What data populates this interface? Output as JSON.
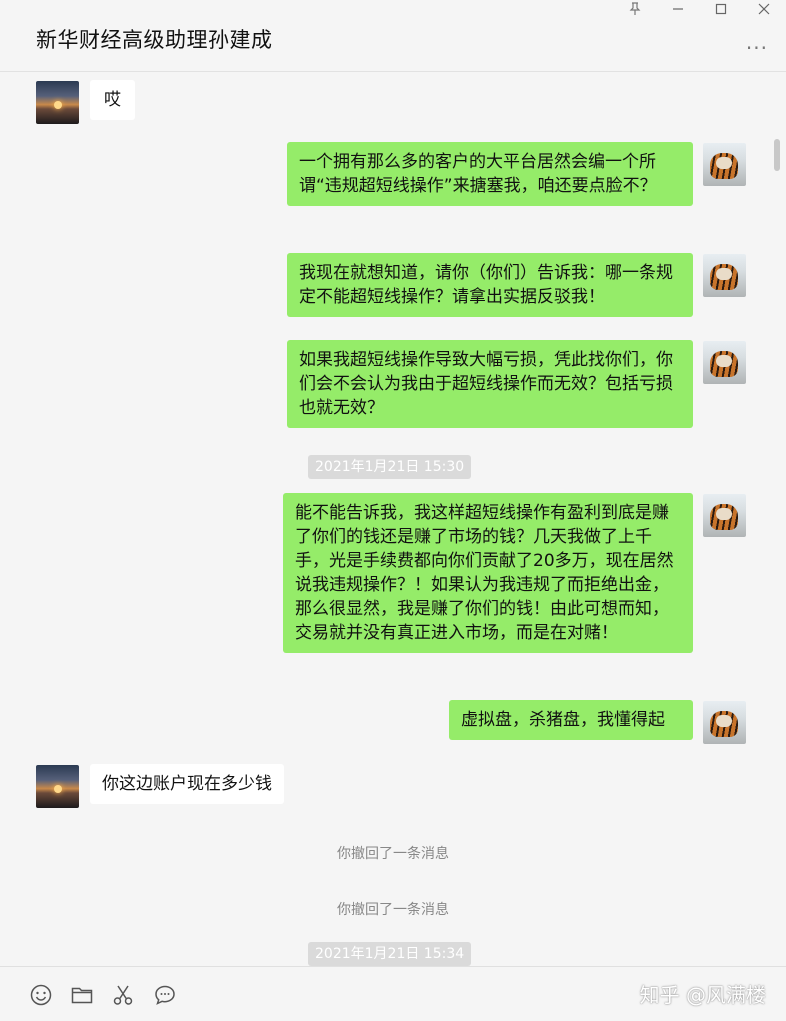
{
  "window": {
    "title": "新华财经高级助理孙建成",
    "more_label": "···"
  },
  "messages": [
    {
      "side": "left",
      "avatar": "sunset-avatar",
      "text": "哎"
    },
    {
      "side": "right",
      "avatar": "tiger-avatar",
      "text": "一个拥有那么多的客户的大平台居然会编一个所谓“违规超短线操作”来搪塞我，咱还要点脸不？"
    },
    {
      "side": "right",
      "avatar": "tiger-avatar",
      "text": "我现在就想知道，请你（你们）告诉我：哪一条规定不能超短线操作？请拿出实据反驳我！"
    },
    {
      "side": "right",
      "avatar": "tiger-avatar",
      "text": "如果我超短线操作导致大幅亏损，凭此找你们，你们会不会认为我由于超短线操作而无效？包括亏损也就无效？"
    },
    {
      "type": "time",
      "text": "2021年1月21日 15:30"
    },
    {
      "side": "right",
      "avatar": "tiger-avatar",
      "text": "能不能告诉我，我这样超短线操作有盈利到底是赚了你们的钱还是赚了市场的钱？几天我做了上千手，光是手续费都向你们贡献了20多万，现在居然说我违规操作？！如果认为我违规了而拒绝出金，那么很显然，我是赚了你们的钱！由此可想而知，交易就并没有真正进入市场，而是在对赌！"
    },
    {
      "side": "right",
      "avatar": "tiger-avatar",
      "text": "虚拟盘，杀猪盘，我懂得起"
    },
    {
      "side": "left",
      "avatar": "sunset-avatar",
      "text": "你这边账户现在多少钱"
    },
    {
      "type": "system",
      "text": "你撤回了一条消息"
    },
    {
      "type": "system",
      "text": "你撤回了一条消息"
    },
    {
      "type": "time",
      "text": "2021年1月21日 15:34"
    }
  ],
  "toolbar": {
    "icons": [
      "emoji-icon",
      "folder-icon",
      "scissors-icon",
      "chat-bubble-icon"
    ],
    "watermark": "知乎 @风满楼"
  },
  "colors": {
    "background": "#f5f5f5",
    "bubble_right": "#95ec69",
    "bubble_left": "#ffffff",
    "time_pill": "#dadada"
  }
}
